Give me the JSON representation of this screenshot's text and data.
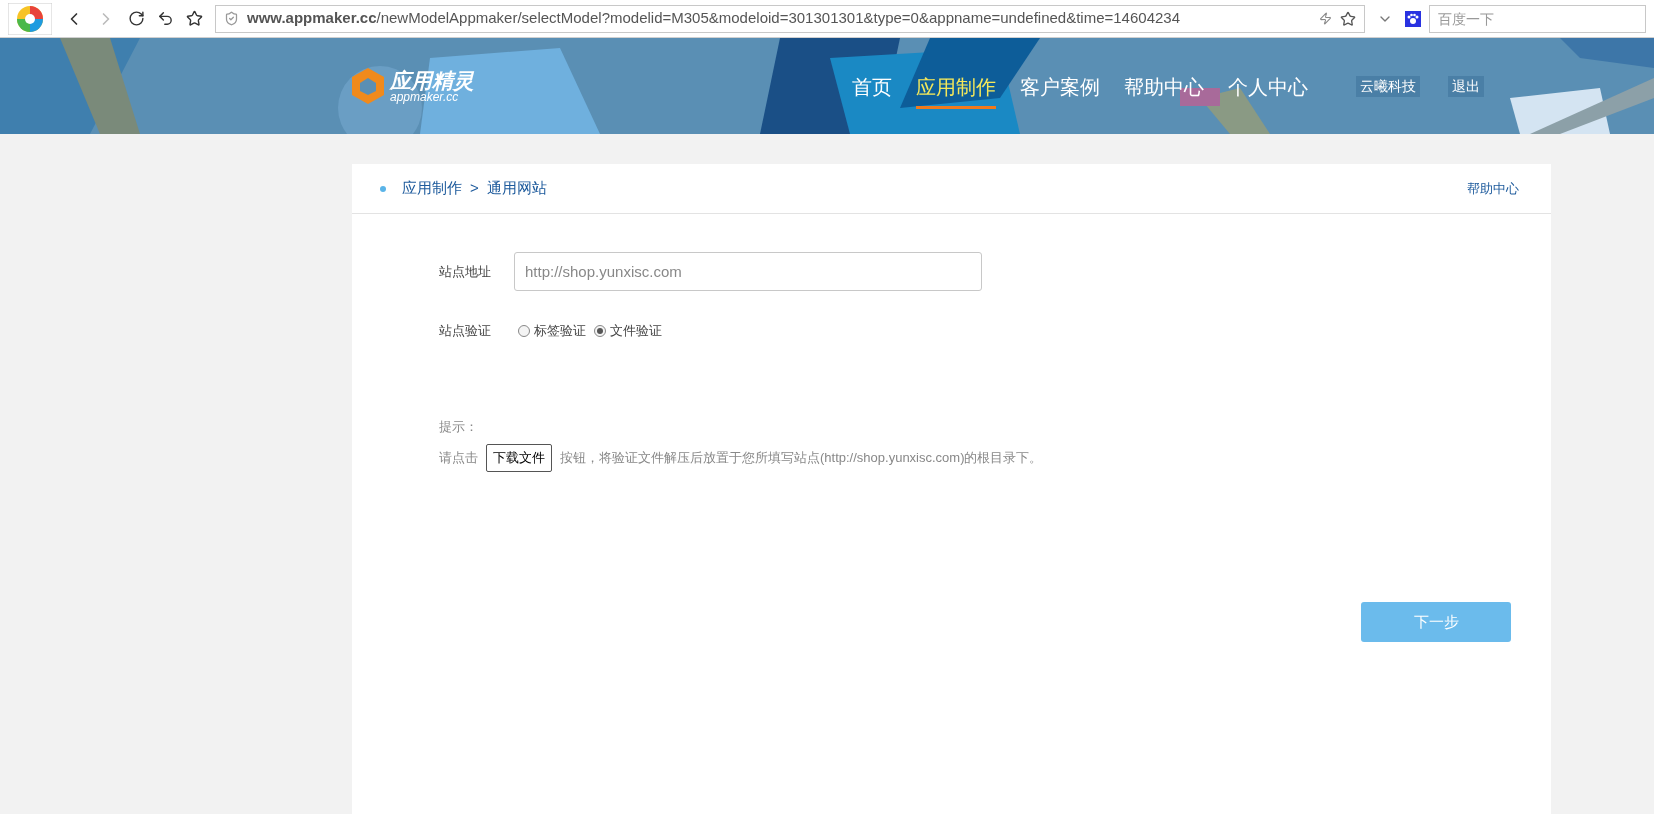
{
  "browser": {
    "url": "**www.appmaker.cc**/newModelAppmaker/selectModel?modelid=M305&modeloid=301301301&type=0&appname=undefined&time=14604234",
    "search_placeholder": "百度一下"
  },
  "header": {
    "logo_title": "应用精灵",
    "logo_subtitle": "appmaker.cc",
    "nav": [
      {
        "label": "首页",
        "selected": false
      },
      {
        "label": "应用制作",
        "selected": true
      },
      {
        "label": "客户案例",
        "selected": false
      },
      {
        "label": "帮助中心",
        "selected": false
      },
      {
        "label": "个人中心",
        "selected": false
      }
    ],
    "user": "云曦科技",
    "logout": "退出"
  },
  "breadcrumb": {
    "items": [
      "应用制作",
      "通用网站"
    ],
    "separator": ">"
  },
  "help_link": "帮助中心",
  "form": {
    "site_label": "站点地址",
    "site_value": "http://shop.yunxisc.com",
    "verify_label": "站点验证",
    "options": [
      {
        "label": "标签验证",
        "selected": false
      },
      {
        "label": "文件验证",
        "selected": true
      }
    ]
  },
  "hint": {
    "title": "提示：",
    "before": "请点击",
    "button": "下载文件",
    "after": "按钮，将验证文件解压后放置于您所填写站点(http://shop.yunxisc.com)的根目录下。"
  },
  "next_button": "下一步"
}
